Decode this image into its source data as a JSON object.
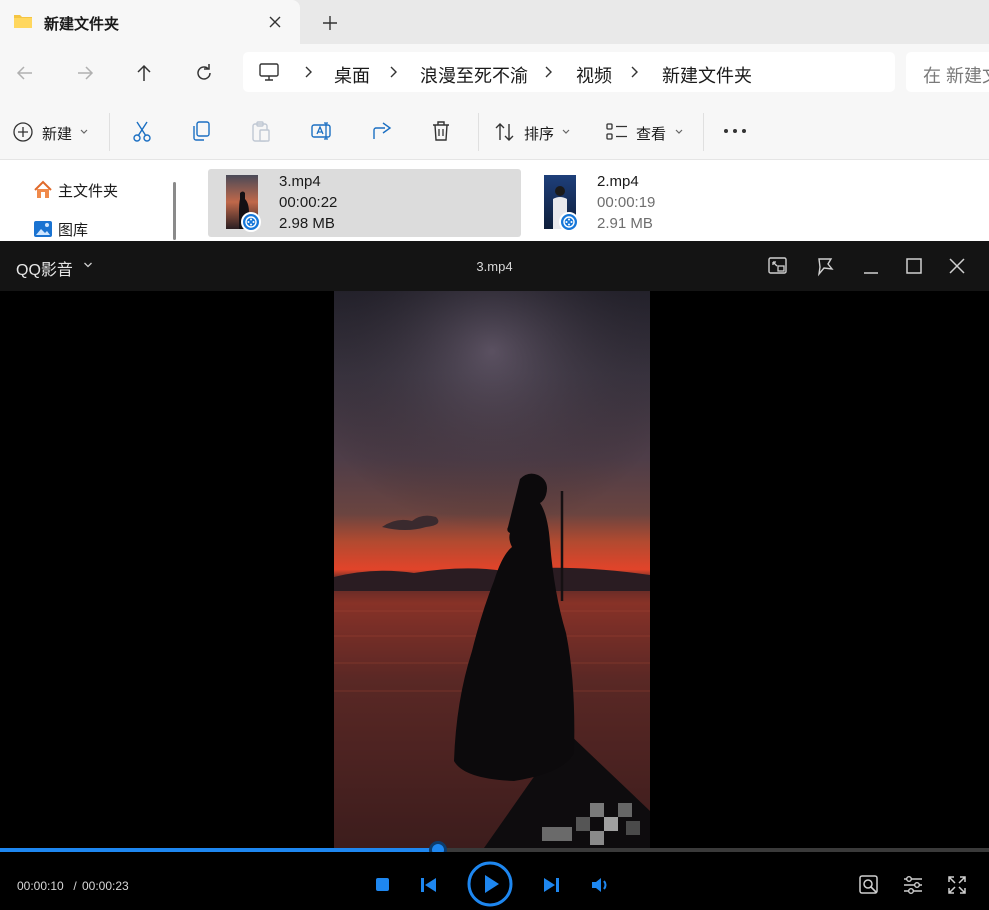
{
  "explorer": {
    "tab": {
      "title": "新建文件夹"
    },
    "breadcrumb": [
      "桌面",
      "浪漫至死不渝",
      "视频",
      "新建文件夹"
    ],
    "search": {
      "placeholder": "在 新建文"
    },
    "toolbar": {
      "new_label": "新建",
      "sort_label": "排序",
      "view_label": "查看"
    },
    "sidebar": [
      {
        "label": "主文件夹",
        "icon": "home-icon"
      },
      {
        "label": "图库",
        "icon": "gallery-icon"
      }
    ],
    "files": [
      {
        "name": "3.mp4",
        "duration": "00:00:22",
        "size": "2.98 MB",
        "selected": true
      },
      {
        "name": "2.mp4",
        "duration": "00:00:19",
        "size": "2.91 MB",
        "selected": false
      }
    ]
  },
  "player": {
    "app_name": "QQ影音",
    "title": "3.mp4",
    "time_current": "00:00:10",
    "time_separator": " / ",
    "time_total": "00:00:23",
    "progress": 0.443,
    "accent": "#1e87f0"
  }
}
